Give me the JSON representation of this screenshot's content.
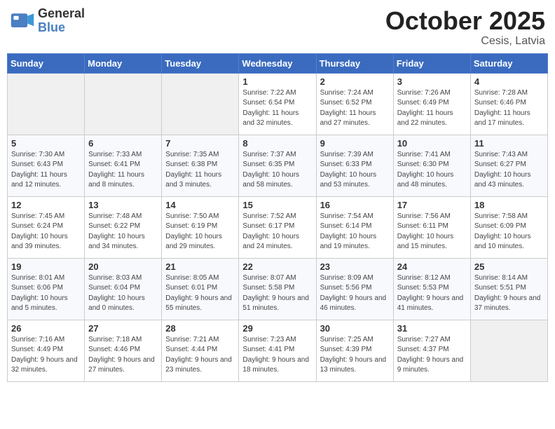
{
  "logo": {
    "general": "General",
    "blue": "Blue"
  },
  "title": {
    "month": "October 2025",
    "location": "Cesis, Latvia"
  },
  "headers": [
    "Sunday",
    "Monday",
    "Tuesday",
    "Wednesday",
    "Thursday",
    "Friday",
    "Saturday"
  ],
  "weeks": [
    [
      {
        "day": "",
        "detail": ""
      },
      {
        "day": "",
        "detail": ""
      },
      {
        "day": "",
        "detail": ""
      },
      {
        "day": "1",
        "detail": "Sunrise: 7:22 AM\nSunset: 6:54 PM\nDaylight: 11 hours\nand 32 minutes."
      },
      {
        "day": "2",
        "detail": "Sunrise: 7:24 AM\nSunset: 6:52 PM\nDaylight: 11 hours\nand 27 minutes."
      },
      {
        "day": "3",
        "detail": "Sunrise: 7:26 AM\nSunset: 6:49 PM\nDaylight: 11 hours\nand 22 minutes."
      },
      {
        "day": "4",
        "detail": "Sunrise: 7:28 AM\nSunset: 6:46 PM\nDaylight: 11 hours\nand 17 minutes."
      }
    ],
    [
      {
        "day": "5",
        "detail": "Sunrise: 7:30 AM\nSunset: 6:43 PM\nDaylight: 11 hours\nand 12 minutes."
      },
      {
        "day": "6",
        "detail": "Sunrise: 7:33 AM\nSunset: 6:41 PM\nDaylight: 11 hours\nand 8 minutes."
      },
      {
        "day": "7",
        "detail": "Sunrise: 7:35 AM\nSunset: 6:38 PM\nDaylight: 11 hours\nand 3 minutes."
      },
      {
        "day": "8",
        "detail": "Sunrise: 7:37 AM\nSunset: 6:35 PM\nDaylight: 10 hours\nand 58 minutes."
      },
      {
        "day": "9",
        "detail": "Sunrise: 7:39 AM\nSunset: 6:33 PM\nDaylight: 10 hours\nand 53 minutes."
      },
      {
        "day": "10",
        "detail": "Sunrise: 7:41 AM\nSunset: 6:30 PM\nDaylight: 10 hours\nand 48 minutes."
      },
      {
        "day": "11",
        "detail": "Sunrise: 7:43 AM\nSunset: 6:27 PM\nDaylight: 10 hours\nand 43 minutes."
      }
    ],
    [
      {
        "day": "12",
        "detail": "Sunrise: 7:45 AM\nSunset: 6:24 PM\nDaylight: 10 hours\nand 39 minutes."
      },
      {
        "day": "13",
        "detail": "Sunrise: 7:48 AM\nSunset: 6:22 PM\nDaylight: 10 hours\nand 34 minutes."
      },
      {
        "day": "14",
        "detail": "Sunrise: 7:50 AM\nSunset: 6:19 PM\nDaylight: 10 hours\nand 29 minutes."
      },
      {
        "day": "15",
        "detail": "Sunrise: 7:52 AM\nSunset: 6:17 PM\nDaylight: 10 hours\nand 24 minutes."
      },
      {
        "day": "16",
        "detail": "Sunrise: 7:54 AM\nSunset: 6:14 PM\nDaylight: 10 hours\nand 19 minutes."
      },
      {
        "day": "17",
        "detail": "Sunrise: 7:56 AM\nSunset: 6:11 PM\nDaylight: 10 hours\nand 15 minutes."
      },
      {
        "day": "18",
        "detail": "Sunrise: 7:58 AM\nSunset: 6:09 PM\nDaylight: 10 hours\nand 10 minutes."
      }
    ],
    [
      {
        "day": "19",
        "detail": "Sunrise: 8:01 AM\nSunset: 6:06 PM\nDaylight: 10 hours\nand 5 minutes."
      },
      {
        "day": "20",
        "detail": "Sunrise: 8:03 AM\nSunset: 6:04 PM\nDaylight: 10 hours\nand 0 minutes."
      },
      {
        "day": "21",
        "detail": "Sunrise: 8:05 AM\nSunset: 6:01 PM\nDaylight: 9 hours\nand 55 minutes."
      },
      {
        "day": "22",
        "detail": "Sunrise: 8:07 AM\nSunset: 5:58 PM\nDaylight: 9 hours\nand 51 minutes."
      },
      {
        "day": "23",
        "detail": "Sunrise: 8:09 AM\nSunset: 5:56 PM\nDaylight: 9 hours\nand 46 minutes."
      },
      {
        "day": "24",
        "detail": "Sunrise: 8:12 AM\nSunset: 5:53 PM\nDaylight: 9 hours\nand 41 minutes."
      },
      {
        "day": "25",
        "detail": "Sunrise: 8:14 AM\nSunset: 5:51 PM\nDaylight: 9 hours\nand 37 minutes."
      }
    ],
    [
      {
        "day": "26",
        "detail": "Sunrise: 7:16 AM\nSunset: 4:49 PM\nDaylight: 9 hours\nand 32 minutes."
      },
      {
        "day": "27",
        "detail": "Sunrise: 7:18 AM\nSunset: 4:46 PM\nDaylight: 9 hours\nand 27 minutes."
      },
      {
        "day": "28",
        "detail": "Sunrise: 7:21 AM\nSunset: 4:44 PM\nDaylight: 9 hours\nand 23 minutes."
      },
      {
        "day": "29",
        "detail": "Sunrise: 7:23 AM\nSunset: 4:41 PM\nDaylight: 9 hours\nand 18 minutes."
      },
      {
        "day": "30",
        "detail": "Sunrise: 7:25 AM\nSunset: 4:39 PM\nDaylight: 9 hours\nand 13 minutes."
      },
      {
        "day": "31",
        "detail": "Sunrise: 7:27 AM\nSunset: 4:37 PM\nDaylight: 9 hours\nand 9 minutes."
      },
      {
        "day": "",
        "detail": ""
      }
    ]
  ]
}
